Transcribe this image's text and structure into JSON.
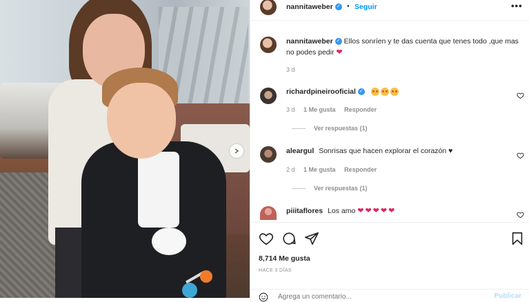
{
  "post": {
    "author": "nannitaweber",
    "follow_label": "Seguir",
    "separator": "•",
    "more_label": "•••",
    "caption": "Ellos sonríen y te das cuenta que tenes todo ,que mas no podes pedir",
    "caption_emoji": "❤",
    "caption_age": "3 d",
    "likes": "8,714 Me gusta",
    "date": "HACE 3 DÍAS"
  },
  "comments": [
    {
      "username": "richardpineirooficial",
      "verified": true,
      "text": "",
      "emojis": [
        "heart-eyes-face",
        "heart-eyes-face",
        "heart-eyes-face"
      ],
      "age": "3 d",
      "likes": "1 Me gusta",
      "reply_label": "Responder",
      "view_replies": "Ver respuestas (1)"
    },
    {
      "username": "aleargul",
      "verified": false,
      "text": "Sonrisas que hacen explorar el corazón",
      "text_suffix": "♥",
      "age": "2 d",
      "likes": "1 Me gusta",
      "reply_label": "Responder",
      "view_replies": "Ver respuestas (1)"
    },
    {
      "username": "piiitaflores",
      "verified": false,
      "text": "Los amo",
      "hearts": "❤❤❤❤❤"
    }
  ],
  "add_comment": {
    "placeholder": "Agrega un comentario...",
    "publish_label": "Publicar"
  },
  "colors": {
    "accent": "#0095f6",
    "verified": "#3897f0",
    "heart": "#e0245e"
  }
}
